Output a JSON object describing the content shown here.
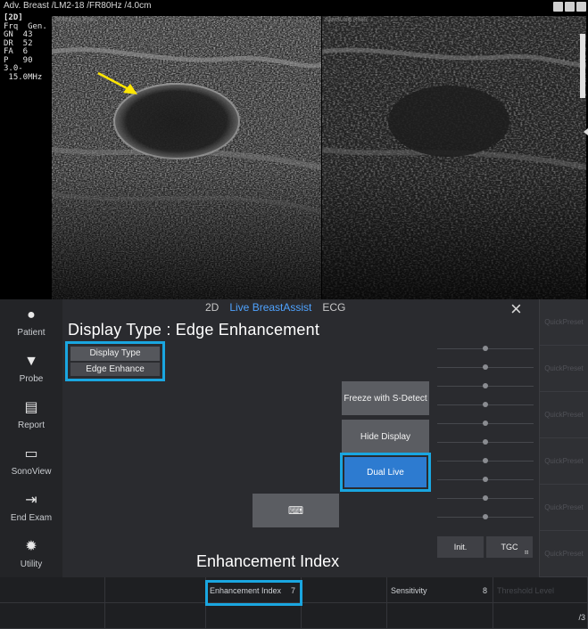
{
  "status_bar": {
    "text": "Adv. Breast /LM2-18 /FR80Hz /4.0cm"
  },
  "parameters": [
    "[2D]",
    "Frq  Gen.",
    "GN  43",
    "DR  52",
    "FA  6",
    "P   90",
    "3.0-",
    " 15.0MHz"
  ],
  "image_brand": "SAMSUNG RS85",
  "tabs": [
    {
      "label": "2D",
      "active": false
    },
    {
      "label": "Live BreastAssist",
      "active": true
    },
    {
      "label": "ECG",
      "active": false
    }
  ],
  "close_label": "×",
  "sidebar": [
    {
      "icon": "person-icon",
      "glyph": "●",
      "label": "Patient"
    },
    {
      "icon": "probe-icon",
      "glyph": "▼",
      "label": "Probe"
    },
    {
      "icon": "report-icon",
      "glyph": "▤",
      "label": "Report"
    },
    {
      "icon": "sonoview-icon",
      "glyph": "▭",
      "label": "SonoView"
    },
    {
      "icon": "end-exam-icon",
      "glyph": "⇥",
      "label": "End Exam"
    },
    {
      "icon": "gear-icon",
      "glyph": "✹",
      "label": "Utility"
    }
  ],
  "quick_presets": [
    "QuickPreset",
    "QuickPreset",
    "QuickPreset",
    "QuickPreset",
    "QuickPreset",
    "QuickPreset"
  ],
  "annotations": {
    "display_type": "Display Type : Edge Enhancement",
    "enhancement_index": "Enhancement Index"
  },
  "display_type": {
    "label": "Display Type",
    "value": "Edge Enhance"
  },
  "buttons": {
    "freeze": "Freeze with S-Detect",
    "hide": "Hide Display",
    "dual": "Dual Live",
    "keyboard_glyph": "⌨",
    "init": "Init.",
    "tgc": "TGC",
    "tgc_sub": "⠶"
  },
  "tgc_sliders": [
    0.5,
    0.5,
    0.5,
    0.5,
    0.5,
    0.5,
    0.5,
    0.5,
    0.5,
    0.5
  ],
  "softkeys": {
    "row1": [
      {
        "label": "",
        "value": ""
      },
      {
        "label": "",
        "value": ""
      },
      {
        "label": "Enhancement Index",
        "value": "7"
      },
      {
        "label": "",
        "value": ""
      },
      {
        "label": "Sensitivity",
        "value": "8"
      },
      {
        "label": "Threshold Level",
        "value": ""
      }
    ],
    "row2": [
      {
        "label": "",
        "value": ""
      },
      {
        "label": "",
        "value": ""
      },
      {
        "label": "",
        "value": ""
      },
      {
        "label": "",
        "value": ""
      },
      {
        "label": "",
        "value": ""
      },
      {
        "label": "",
        "value": ""
      }
    ]
  },
  "page_indicator": "/3",
  "colors": {
    "accent": "#1aa6e0",
    "active_tab": "#4fa3ff",
    "dual_live": "#2d7bd0",
    "arrow": "#ffe600"
  }
}
